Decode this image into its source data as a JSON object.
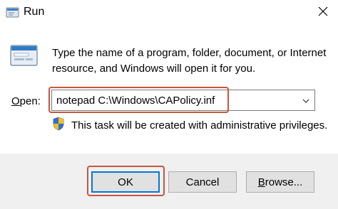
{
  "window": {
    "title": "Run",
    "icon": "run-app-icon",
    "close_icon": "close-icon"
  },
  "content": {
    "description": "Type the name of a program, folder, document, or Internet resource, and Windows will open it for you.",
    "run_icon": "run-dialog-icon"
  },
  "open_field": {
    "label_mnemonic": "O",
    "label_rest": "pen:",
    "value": "notepad C:\\Windows\\CAPolicy.inf",
    "dropdown_icon": "chevron-down-icon"
  },
  "admin_notice": {
    "icon": "uac-shield-icon",
    "text": "This task will be created with administrative privileges."
  },
  "buttons": {
    "ok": "OK",
    "cancel": "Cancel",
    "browse_mnemonic": "B",
    "browse_rest": "rowse..."
  },
  "colors": {
    "highlight_outline": "#c8553d",
    "focus_border": "#0078d7",
    "button_face": "#e1e1e1",
    "footer_bg": "#f0f0f0"
  }
}
